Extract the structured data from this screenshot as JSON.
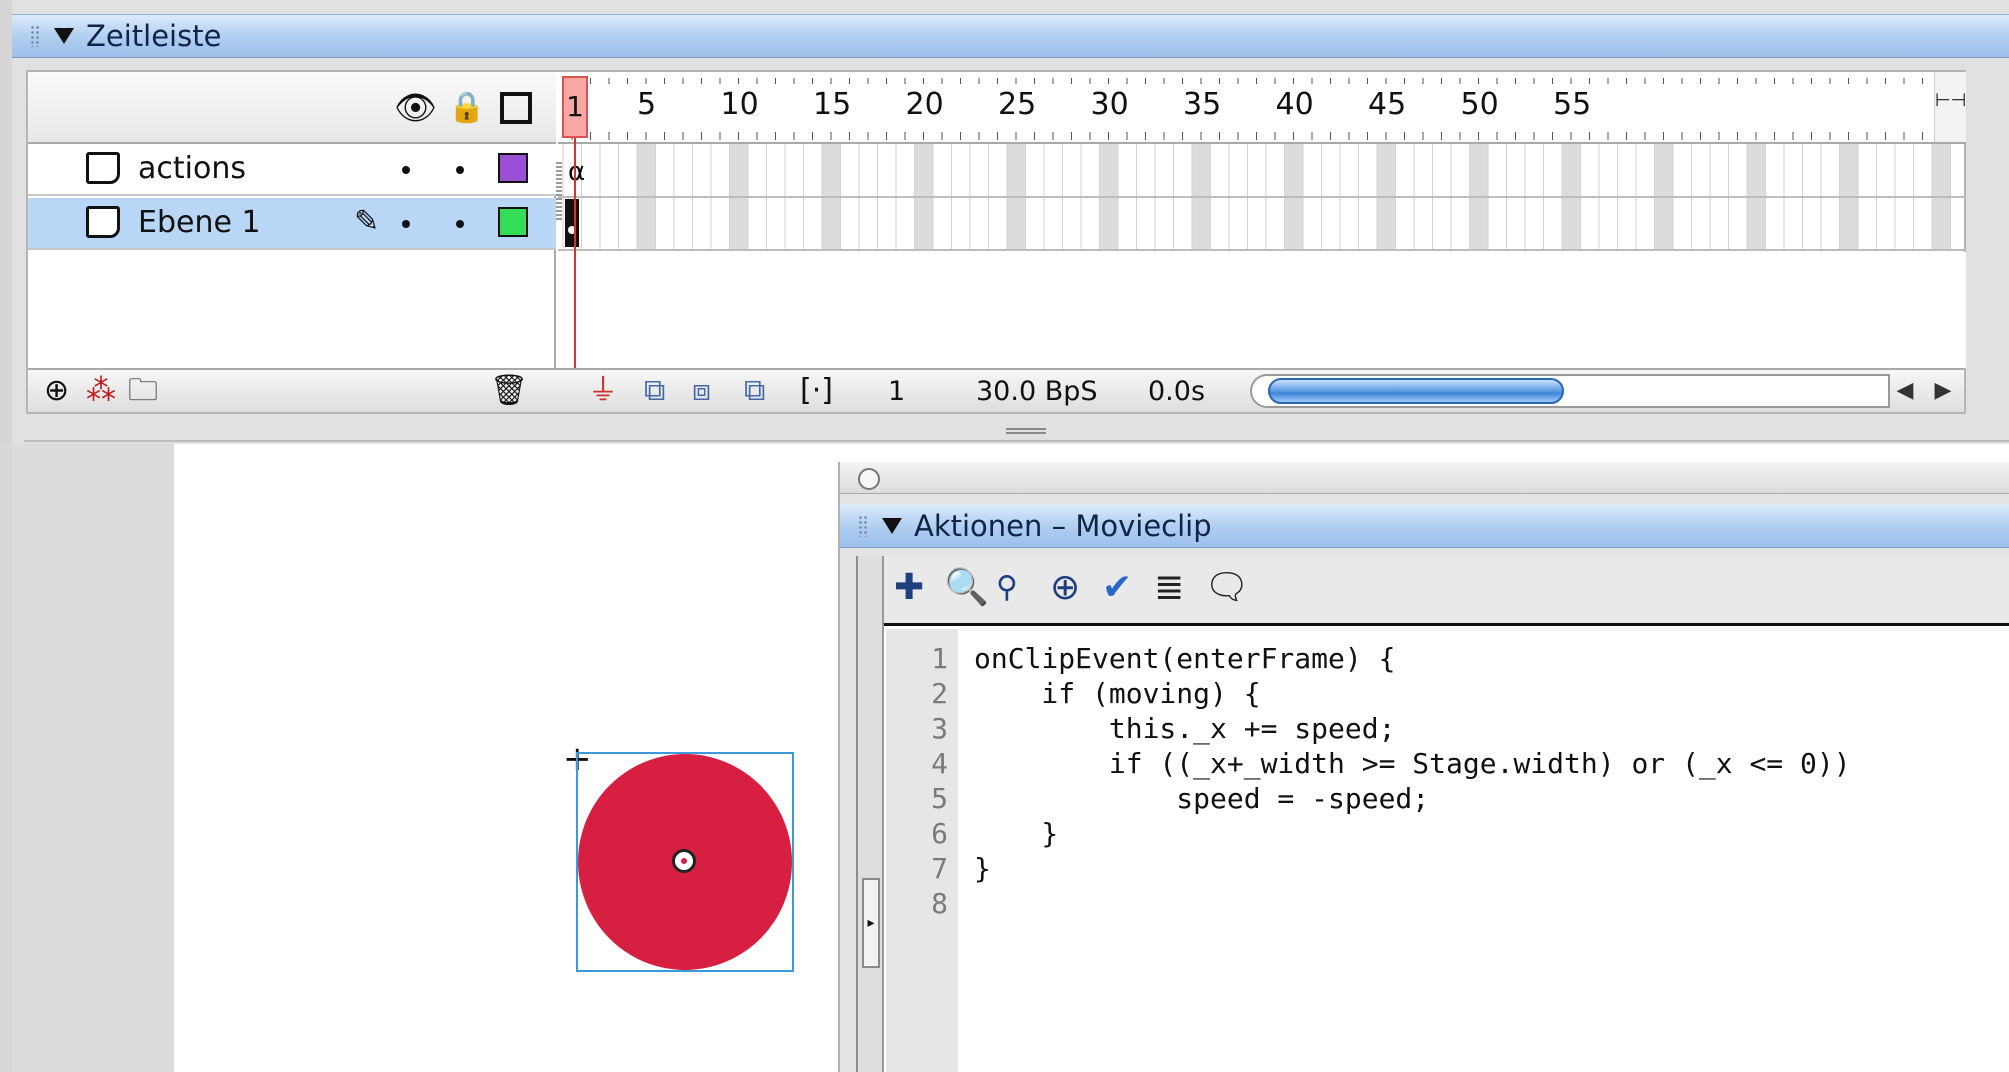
{
  "timeline": {
    "title": "Zeitleiste",
    "frame_numbers": [
      "1",
      "5",
      "10",
      "15",
      "20",
      "25",
      "30",
      "35",
      "40",
      "45",
      "50",
      "55"
    ],
    "layers": [
      {
        "name": "actions",
        "color": "#9b4fd6",
        "selected": false
      },
      {
        "name": "Ebene 1",
        "color": "#33dd55",
        "selected": true
      }
    ],
    "footer": {
      "current_frame": "1",
      "frame_rate": "30.0 BpS",
      "elapsed": "0.0s"
    },
    "icons": {
      "eye": "eye-icon",
      "lock": "lock-icon",
      "outline": "outline-square-icon",
      "add_layer": "add-layer-icon",
      "add_motion_guide": "add-motion-guide-icon",
      "add_folder": "add-folder-icon",
      "delete": "trash-icon"
    }
  },
  "actions_panel": {
    "title": "Aktionen – Movieclip",
    "toolbar": [
      "add-statement-icon",
      "find-icon",
      "replace-icon",
      "target-path-icon",
      "check-syntax-icon",
      "auto-format-icon",
      "code-hint-icon"
    ],
    "code": [
      {
        "num": "1",
        "text": "onClipEvent(enterFrame) {"
      },
      {
        "num": "2",
        "text": "    if (moving) {"
      },
      {
        "num": "3",
        "text": "        this._x += speed;"
      },
      {
        "num": "4",
        "text": "        if ((_x+_width >= Stage.width) or (_x <= 0))"
      },
      {
        "num": "5",
        "text": "            speed = -speed;"
      },
      {
        "num": "6",
        "text": "    }"
      },
      {
        "num": "7",
        "text": "}"
      },
      {
        "num": "8",
        "text": ""
      }
    ]
  },
  "stage": {
    "circle_color": "#d71f42",
    "selection_color": "#3d9ad6"
  }
}
